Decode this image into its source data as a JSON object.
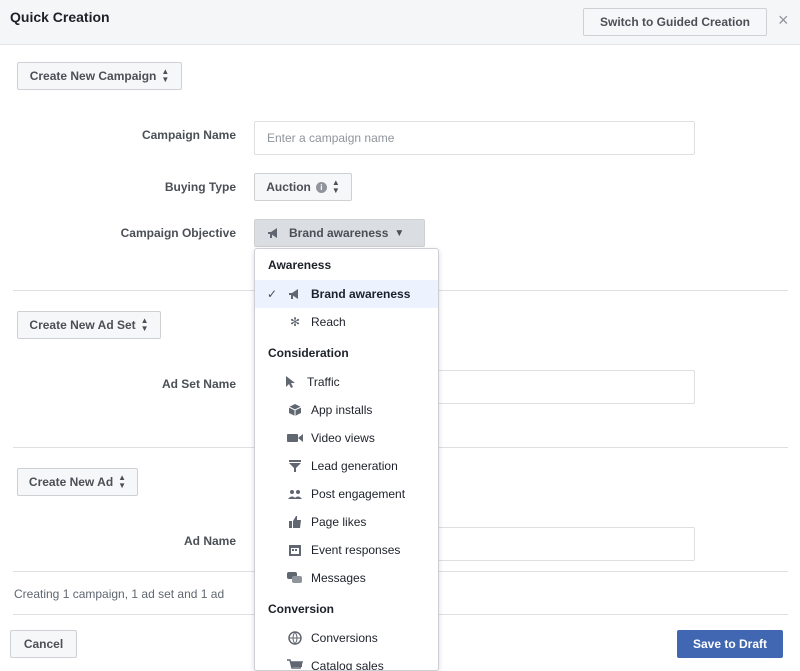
{
  "header": {
    "title": "Quick Creation",
    "switch_label": "Switch to Guided Creation",
    "close_glyph": "×"
  },
  "campaign": {
    "create_label": "Create New Campaign",
    "name_label": "Campaign Name",
    "name_placeholder": "Enter a campaign name",
    "buying_type_label": "Buying Type",
    "buying_type_value": "Auction",
    "objective_label": "Campaign Objective",
    "objective_value": "Brand awareness"
  },
  "adset": {
    "create_label": "Create New Ad Set",
    "name_label": "Ad Set Name"
  },
  "ad": {
    "create_label": "Create New Ad",
    "name_label": "Ad Name"
  },
  "dropdown": {
    "groups": [
      {
        "heading": "Awareness",
        "items": [
          {
            "label": "Brand awareness",
            "icon": "megaphone-icon",
            "selected": true
          },
          {
            "label": "Reach",
            "icon": "reach-icon",
            "selected": false
          }
        ]
      },
      {
        "heading": "Consideration",
        "items": [
          {
            "label": "Traffic",
            "icon": "cursor-icon"
          },
          {
            "label": "App installs",
            "icon": "box-icon"
          },
          {
            "label": "Video views",
            "icon": "video-camera-icon"
          },
          {
            "label": "Lead generation",
            "icon": "funnel-icon"
          },
          {
            "label": "Post engagement",
            "icon": "people-icon"
          },
          {
            "label": "Page likes",
            "icon": "thumbs-up-icon"
          },
          {
            "label": "Event responses",
            "icon": "calendar-icon"
          },
          {
            "label": "Messages",
            "icon": "chat-bubbles-icon"
          }
        ]
      },
      {
        "heading": "Conversion",
        "items": [
          {
            "label": "Conversions",
            "icon": "globe-icon"
          },
          {
            "label": "Catalog sales",
            "icon": "cart-icon"
          }
        ]
      }
    ]
  },
  "footer": {
    "summary": "Creating 1 campaign, 1 ad set and 1 ad",
    "cancel_label": "Cancel",
    "save_label": "Save to Draft"
  },
  "colors": {
    "primary": "#4267b2",
    "selected_bg": "#ecf3ff",
    "header_bg": "#f5f6f7"
  }
}
